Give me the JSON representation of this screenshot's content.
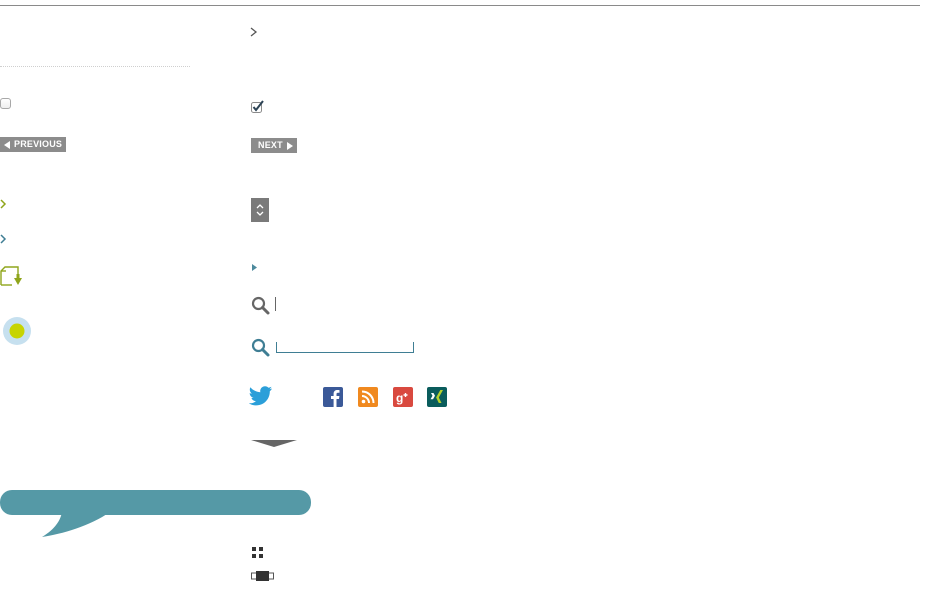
{
  "pagination": {
    "previous_label": "PREVIOUS",
    "next_label": "NEXT"
  },
  "icons": [
    "chevron-right-icon",
    "checkbox-icon",
    "checked-checkbox-icon",
    "previous-arrow-icon",
    "next-arrow-icon",
    "select-arrows-icon",
    "green-chevron-icon",
    "blue-chevron-icon",
    "play-triangle-icon",
    "folder-download-icon",
    "search-icon",
    "radio-dot-icon",
    "twitter-icon",
    "facebook-icon",
    "rss-icon",
    "google-plus-icon",
    "xing-icon",
    "dropdown-caret-icon",
    "speech-bubble",
    "grid-icon",
    "slider-handle-icon"
  ],
  "colors": {
    "accent_green": "#8fa51b",
    "accent_teal": "#5599a6",
    "link_blue": "#3f7e94",
    "button_gray": "#8c8c8c",
    "radio_yellow": "#c7d400",
    "radio_halo": "#c6e0ef"
  }
}
